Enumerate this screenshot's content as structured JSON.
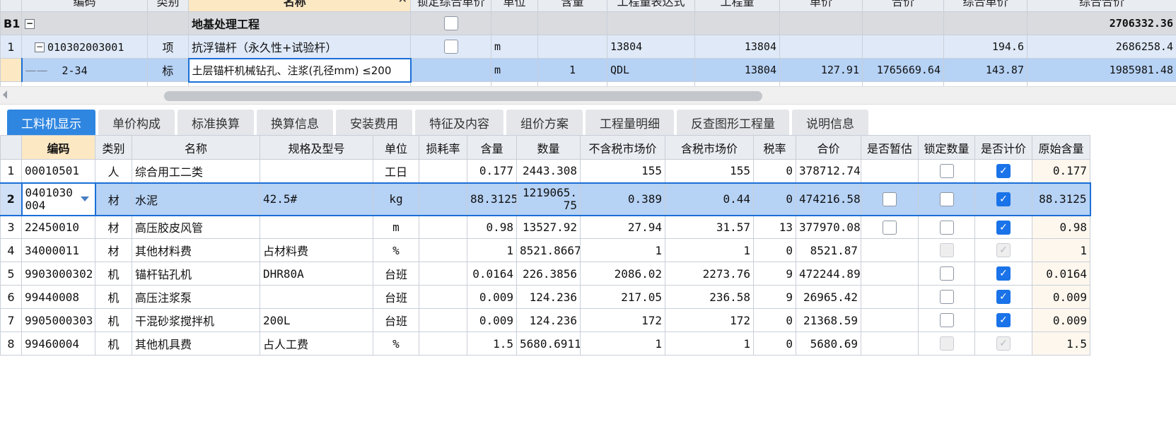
{
  "top_grid": {
    "headers": [
      "编码",
      "类别",
      "名称",
      "锁定综合单价",
      "单位",
      "含量",
      "工程量表达式",
      "工程量",
      "单价",
      "合价",
      "综合单价",
      "综合合价"
    ],
    "close_label": "✕",
    "rows": [
      {
        "rn": "B1",
        "code": "",
        "type": "",
        "name": "地基处理工程",
        "unit": "",
        "content": "",
        "expr": "",
        "qty": "",
        "price": "",
        "total": "",
        "comp_price": "",
        "comp_total": "2706332.36"
      },
      {
        "rn": "1",
        "code": "010302003001",
        "type": "项",
        "name": "抗浮锚杆（永久性+试验杆）",
        "unit": "m",
        "content": "",
        "expr": "13804",
        "qty": "13804",
        "price": "",
        "total": "",
        "comp_price": "194.6",
        "comp_total": "2686258.4"
      },
      {
        "rn": "",
        "code": "2-34",
        "type": "标",
        "name": "土层锚杆机械钻孔、注浆(孔径mm) ≤200",
        "unit": "m",
        "content": "1",
        "expr": "QDL",
        "qty": "13804",
        "price": "127.91",
        "total": "1765669.64",
        "comp_price": "143.87",
        "comp_total": "1985981.48"
      }
    ]
  },
  "tabs": [
    "工料机显示",
    "单价构成",
    "标准换算",
    "换算信息",
    "安装费用",
    "特征及内容",
    "组价方案",
    "工程量明细",
    "反查图形工程量",
    "说明信息"
  ],
  "bottom_grid": {
    "headers": [
      "编码",
      "类别",
      "名称",
      "规格及型号",
      "单位",
      "损耗率",
      "含量",
      "数量",
      "不含税市场价",
      "含税市场价",
      "税率",
      "合价",
      "是否暂估",
      "锁定数量",
      "是否计价",
      "原始含量"
    ],
    "rows": [
      {
        "rn": "1",
        "code": "00010501",
        "type": "人",
        "name": "综合用工二类",
        "spec": "",
        "unit": "工日",
        "loss": "",
        "content": "0.177",
        "qty": "2443.308",
        "price_ex": "155",
        "price_in": "155",
        "tax": "0",
        "total": "378712.74",
        "orig": "0.177"
      },
      {
        "rn": "2",
        "code": "0401030 004",
        "type": "材",
        "name": "水泥",
        "spec": "42.5#",
        "unit": "kg",
        "loss": "",
        "content": "88.3125",
        "qty": "1219065.75",
        "price_ex": "0.389",
        "price_in": "0.44",
        "tax": "0",
        "total": "474216.58",
        "orig": "88.3125"
      },
      {
        "rn": "3",
        "code": "22450010",
        "type": "材",
        "name": "高压胶皮风管",
        "spec": "",
        "unit": "m",
        "loss": "",
        "content": "0.98",
        "qty": "13527.92",
        "price_ex": "27.94",
        "price_in": "31.57",
        "tax": "13",
        "total": "377970.08",
        "orig": "0.98"
      },
      {
        "rn": "4",
        "code": "34000011",
        "type": "材",
        "name": "其他材料费",
        "spec": "占材料费",
        "unit": "%",
        "loss": "",
        "content": "1",
        "qty": "8521.8667",
        "price_ex": "1",
        "price_in": "1",
        "tax": "0",
        "total": "8521.87",
        "orig": "1"
      },
      {
        "rn": "5",
        "code": "9903000302",
        "type": "机",
        "name": "锚杆钻孔机",
        "spec": "DHR80A",
        "unit": "台班",
        "loss": "",
        "content": "0.0164",
        "qty": "226.3856",
        "price_ex": "2086.02",
        "price_in": "2273.76",
        "tax": "9",
        "total": "472244.89",
        "orig": "0.0164"
      },
      {
        "rn": "6",
        "code": "99440008",
        "type": "机",
        "name": "高压注浆泵",
        "spec": "",
        "unit": "台班",
        "loss": "",
        "content": "0.009",
        "qty": "124.236",
        "price_ex": "217.05",
        "price_in": "236.58",
        "tax": "9",
        "total": "26965.42",
        "orig": "0.009"
      },
      {
        "rn": "7",
        "code": "9905000303",
        "type": "机",
        "name": "干混砂浆搅拌机",
        "spec": "200L",
        "unit": "台班",
        "loss": "",
        "content": "0.009",
        "qty": "124.236",
        "price_ex": "172",
        "price_in": "172",
        "tax": "0",
        "total": "21368.59",
        "orig": "0.009"
      },
      {
        "rn": "8",
        "code": "99460004",
        "type": "机",
        "name": "其他机具费",
        "spec": "占人工费",
        "unit": "%",
        "loss": "",
        "content": "1.5",
        "qty": "5680.6911",
        "price_ex": "1",
        "price_in": "1",
        "tax": "0",
        "total": "5680.69",
        "orig": "1.5"
      }
    ]
  },
  "glyphs": {
    "minus": "−",
    "check": "✓"
  }
}
